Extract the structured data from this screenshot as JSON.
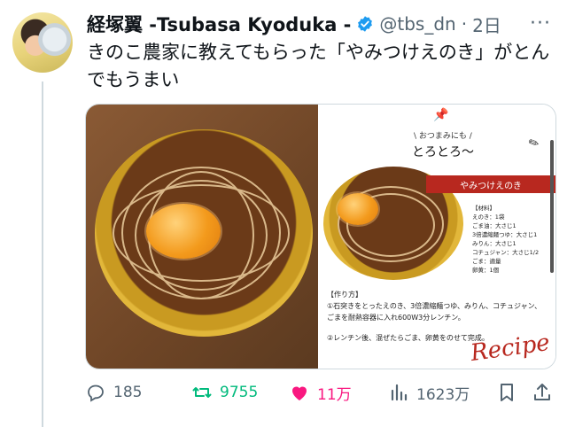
{
  "author": {
    "display_name": "経塚翼 -Tsubasa Kyoduka -",
    "handle": "@tbs_dn",
    "separator": "·",
    "time": "2日",
    "more": "···"
  },
  "tweet": {
    "text": "きのこ農家に教えてもらった「やみつけえのき」がとんでもうまい"
  },
  "media": {
    "recipe": {
      "tag": "\\ おつまみにも /",
      "title": "とろとろ〜",
      "banner": "やみつけえのき",
      "ingredients_heading": "【材料】",
      "ingredients": [
        "えのき：1袋",
        "ごま油：大さじ1",
        "3倍濃縮麺つゆ：大さじ1",
        "みりん：大さじ1",
        "コチュジャン：大さじ1/2",
        "ごま：適量",
        "卵黄：1個"
      ],
      "steps_heading": "【作り方】",
      "step1": "①石突きをとったえのき、3倍濃縮麺つゆ、みりん、コチュジャン、ごまを耐熱容器に入れ600W3分レンチン。",
      "step2": "②レンチン後、混ぜたらごま、卵黄をのせて完成。",
      "script": "Recipe"
    }
  },
  "actions": {
    "replies": "185",
    "retweets": "9755",
    "likes": "11万",
    "views": "1623万"
  },
  "colors": {
    "retweet": "#00ba7c",
    "like": "#f91880",
    "muted": "#536471",
    "verified": "#1d9bf0",
    "recipe_red": "#b8281f"
  }
}
